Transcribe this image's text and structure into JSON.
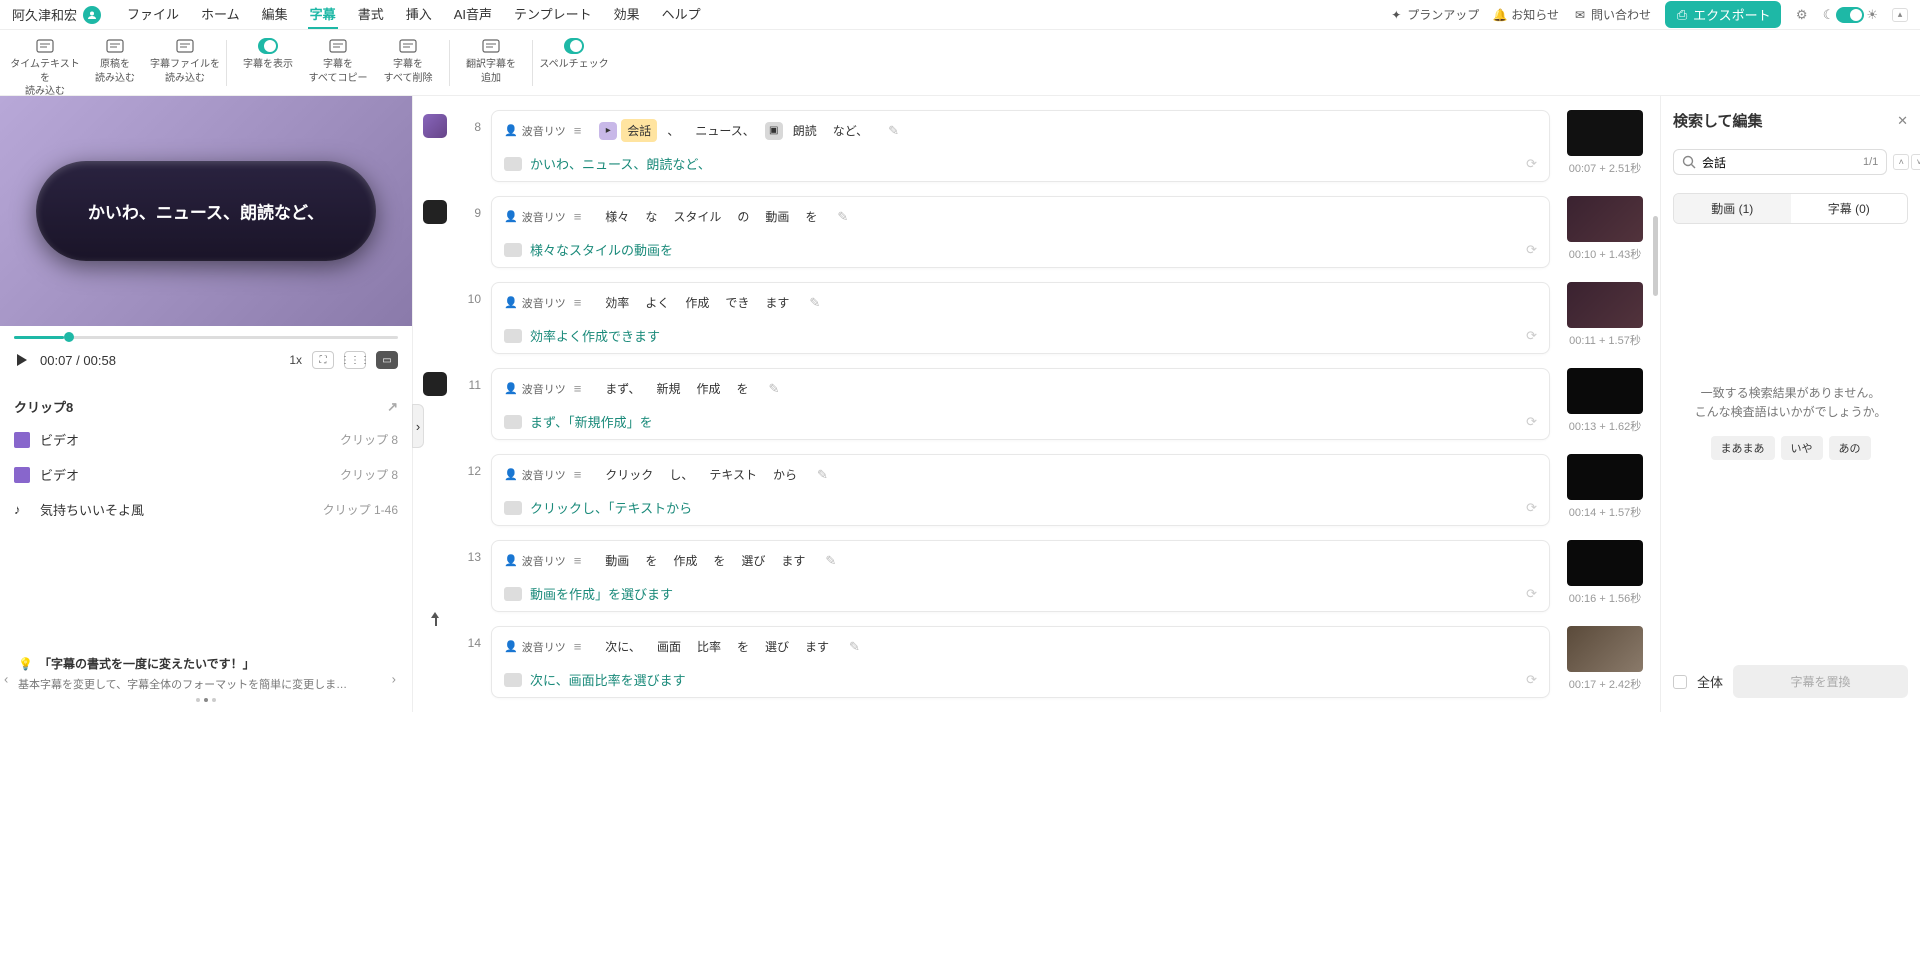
{
  "user": {
    "name": "阿久津和宏"
  },
  "menu": {
    "items": [
      "ファイル",
      "ホーム",
      "編集",
      "字幕",
      "書式",
      "挿入",
      "AI音声",
      "テンプレート",
      "効果",
      "ヘルプ"
    ],
    "active_index": 3
  },
  "topright": {
    "plan": "プランアップ",
    "notice": "お知らせ",
    "contact": "問い合わせ",
    "export": "エクスポート"
  },
  "ribbon": [
    {
      "label": "タイムテキストを\n読み込む"
    },
    {
      "label": "原稿を\n読み込む"
    },
    {
      "label": "字幕ファイルを\n読み込む"
    },
    {
      "label": "字幕を表示",
      "toggle": true
    },
    {
      "label": "字幕を\nすべてコピー"
    },
    {
      "label": "字幕を\nすべて削除"
    },
    {
      "label": "翻訳字幕を\n追加"
    },
    {
      "label": "スペルチェック",
      "toggle": true
    }
  ],
  "preview": {
    "caption": "かいわ、ニュース、朗読など、"
  },
  "player": {
    "current": "00:07",
    "total": "00:58",
    "speed": "1x"
  },
  "clips": {
    "title": "クリップ8",
    "rows": [
      {
        "icon": "video",
        "label": "ビデオ",
        "tag": "クリップ 8"
      },
      {
        "icon": "video",
        "label": "ビデオ",
        "tag": "クリップ 8"
      },
      {
        "icon": "audio",
        "label": "気持ちいいそよ風",
        "tag": "クリップ 1-46"
      }
    ]
  },
  "tip": {
    "title": "「字幕の書式を一度に変えたいです！」",
    "desc": "基本字幕を変更して、字幕全体のフォーマットを簡単に変更しま…"
  },
  "subs": [
    {
      "n": 8,
      "speaker": "波音リツ",
      "scene": "purple",
      "checkbox": true,
      "words": [
        {
          "t": "_marker",
          "v": true
        },
        {
          "t": "会話",
          "hl": true
        },
        {
          "t": "、"
        },
        {
          "t": "ニュース、"
        },
        {
          "t": "_marker",
          "d": true
        },
        {
          "t": "朗読"
        },
        {
          "t": "など、"
        }
      ],
      "sub": "かいわ、ニュース、朗読など、",
      "ts": "00:07 + 2.51秒",
      "thumb_bg": "#111"
    },
    {
      "n": 9,
      "speaker": "波音リツ",
      "scene": "dark",
      "words": [
        {
          "t": "様々"
        },
        {
          "t": "な"
        },
        {
          "t": "スタイル"
        },
        {
          "t": "の"
        },
        {
          "t": "動画"
        },
        {
          "t": "を"
        }
      ],
      "sub": "様々なスタイルの動画を",
      "ts": "00:10 + 1.43秒",
      "thumb_bg": "linear-gradient(135deg,#3a2230,#52333c)"
    },
    {
      "n": 10,
      "speaker": "波音リツ",
      "words": [
        {
          "t": "効率"
        },
        {
          "t": "よく"
        },
        {
          "t": "作成"
        },
        {
          "t": "でき"
        },
        {
          "t": "ます"
        }
      ],
      "sub": "効率よく作成できます",
      "ts": "00:11 + 1.57秒",
      "thumb_bg": "linear-gradient(135deg,#3a2230,#52333c)"
    },
    {
      "n": 11,
      "speaker": "波音リツ",
      "scene": "dark",
      "words": [
        {
          "t": "まず、"
        },
        {
          "t": "新規"
        },
        {
          "t": "作成"
        },
        {
          "t": "を"
        }
      ],
      "sub": "まず、「新規作成」を",
      "ts": "00:13 + 1.62秒",
      "thumb_bg": "#0a0a0a"
    },
    {
      "n": 12,
      "speaker": "波音リツ",
      "words": [
        {
          "t": "クリック"
        },
        {
          "t": "し、"
        },
        {
          "t": "テキスト"
        },
        {
          "t": "から"
        }
      ],
      "sub": "クリックし、「テキストから",
      "ts": "00:14 + 1.57秒",
      "thumb_bg": "#0a0a0a"
    },
    {
      "n": 13,
      "speaker": "波音リツ",
      "words": [
        {
          "t": "動画"
        },
        {
          "t": "を"
        },
        {
          "t": "作成"
        },
        {
          "t": "を"
        },
        {
          "t": "選び"
        },
        {
          "t": "ます"
        }
      ],
      "sub": "動画を作成」を選びます",
      "ts": "00:16 + 1.56秒",
      "thumb_bg": "#0a0a0a"
    },
    {
      "n": 14,
      "speaker": "波音リツ",
      "hasPlayhead": true,
      "words": [
        {
          "t": "次に、"
        },
        {
          "t": "画面"
        },
        {
          "t": "比率"
        },
        {
          "t": "を"
        },
        {
          "t": "選び"
        },
        {
          "t": "ます"
        }
      ],
      "sub": "次に、画面比率を選びます",
      "ts": "00:17 + 2.42秒",
      "thumb_bg": "linear-gradient(135deg,#5a4a3a,#8a7a6a)"
    }
  ],
  "search": {
    "title": "検索して編集",
    "value": "会話",
    "count": "1/1",
    "tabs": {
      "video": "動画 (1)",
      "sub": "字幕 (0)"
    },
    "empty1": "一致する検索結果がありません。",
    "empty2": "こんな検査語はいかがでしょうか。",
    "suggestions": [
      "まあまあ",
      "いや",
      "あの"
    ],
    "all": "全体",
    "replace": "字幕を置換"
  }
}
